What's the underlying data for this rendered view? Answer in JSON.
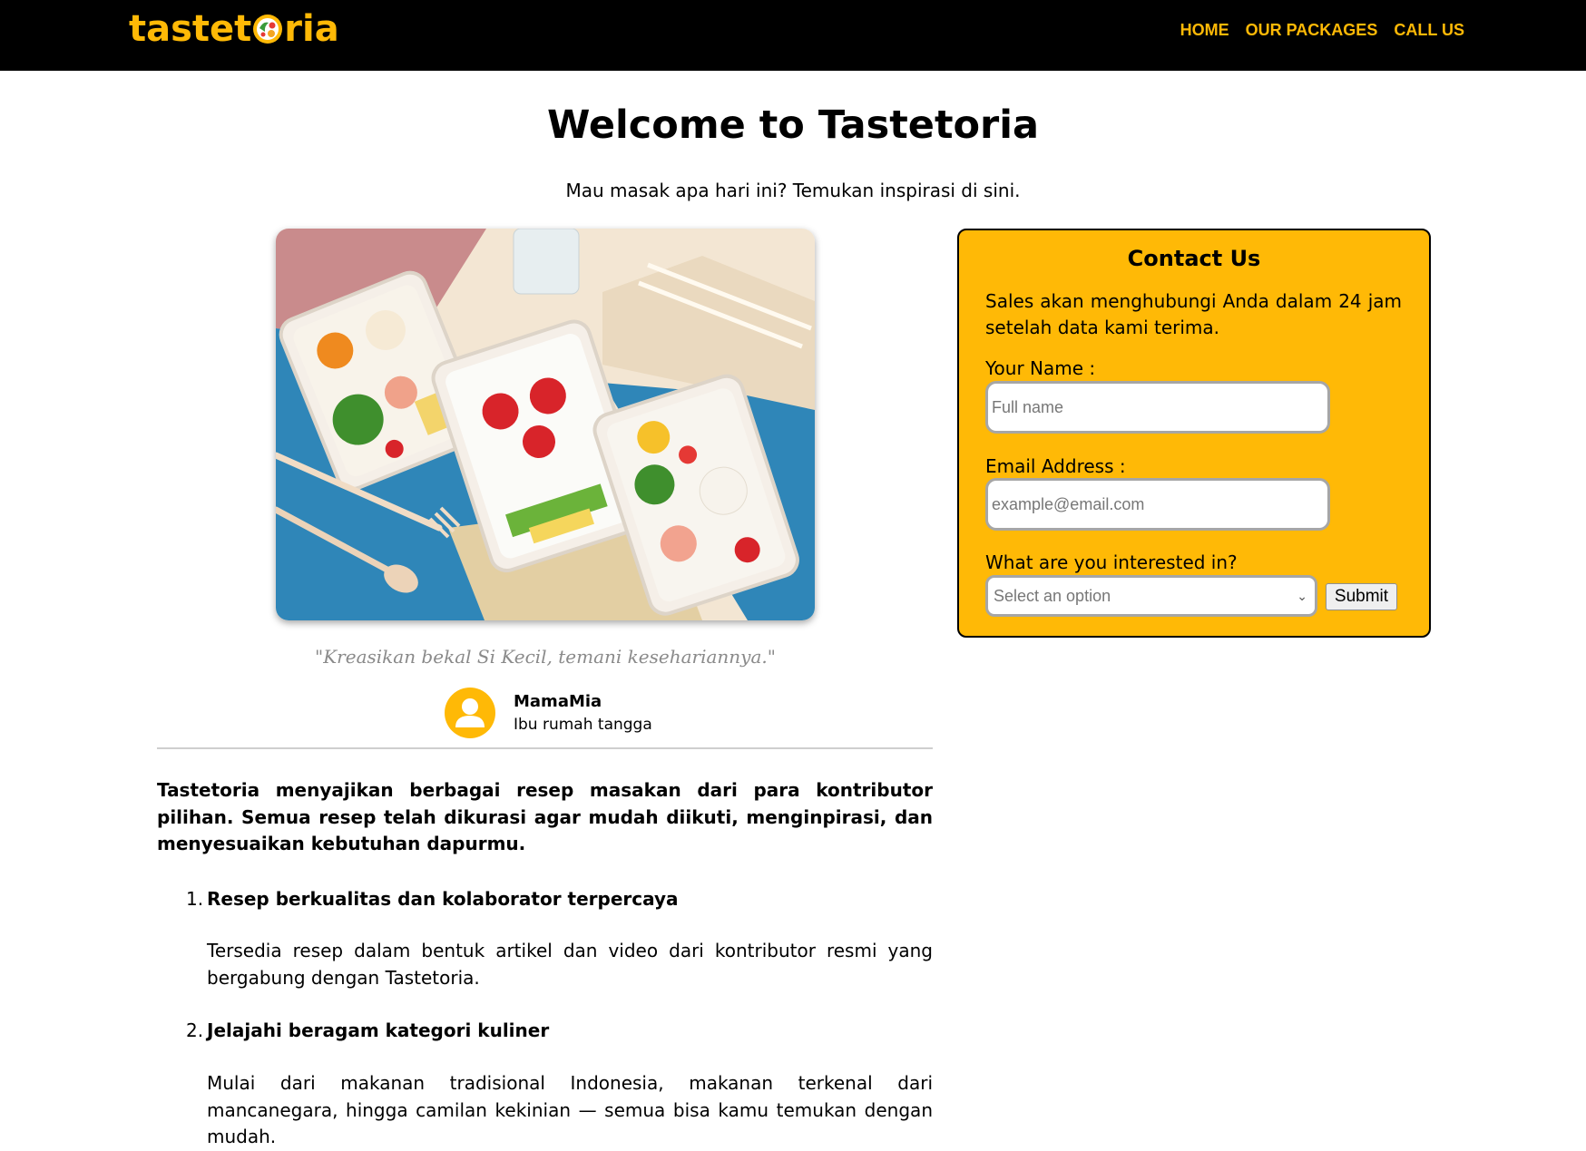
{
  "header": {
    "logo_text": "tastetoria",
    "nav": [
      "HOME",
      "OUR PACKAGES",
      "CALL US"
    ]
  },
  "hero": {
    "title": "Welcome to Tastetoria",
    "tagline": "Mau masak apa hari ini? Temukan inspirasi di sini."
  },
  "testimonial": {
    "quote": "\"Kreasikan bekal Si Kecil, temani kesehariannya.\"",
    "author_name": "MamaMia",
    "author_role": "Ibu rumah tangga"
  },
  "intro": "Tastetoria menyajikan berbagai resep masakan dari para kontributor pilihan. Semua resep telah dikurasi agar mudah diikuti, menginpirasi, dan menyesuaikan kebutuhan dapurmu.",
  "features": [
    {
      "num": "1.",
      "title": "Resep berkualitas dan kolaborator terpercaya",
      "desc": "Tersedia resep dalam bentuk artikel dan video dari kontributor resmi yang bergabung dengan Tastetoria."
    },
    {
      "num": "2.",
      "title": "Jelajahi beragam kategori kuliner",
      "desc": "Mulai dari makanan tradisional Indonesia, makanan terkenal dari mancanegara, hingga camilan kekinian — semua bisa kamu temukan dengan mudah."
    }
  ],
  "contact": {
    "title": "Contact Us",
    "description": "Sales akan menghubungi Anda dalam 24 jam setelah data kami terima.",
    "name_label": "Your Name :",
    "name_placeholder": "Full name",
    "email_label": "Email Address :",
    "email_placeholder": "example@email.com",
    "interest_label": "What are you interested in?",
    "select_value": "Select an option",
    "submit_label": "Submit"
  },
  "colors": {
    "accent": "#ffb906",
    "header_bg": "#000000"
  }
}
